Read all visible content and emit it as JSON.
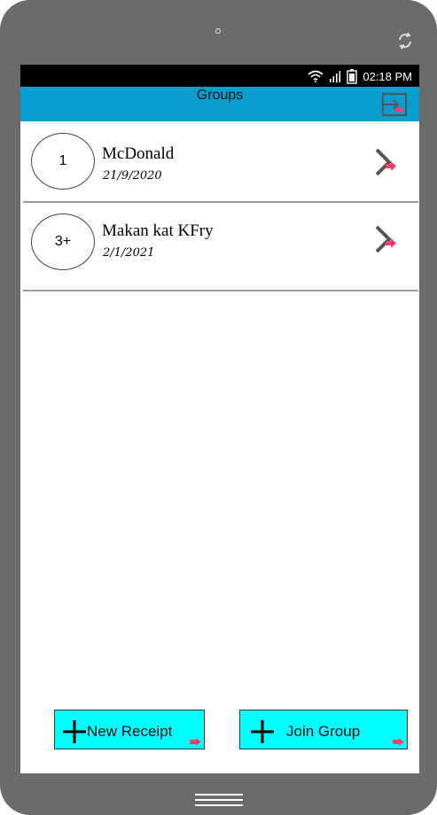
{
  "device": {
    "camera_icon": "front-camera-dot",
    "rotate_icon": "rotate-icon",
    "home_icon": "menu-lines-icon"
  },
  "status_bar": {
    "time": "02:18 PM",
    "icons": [
      "wifi-icon",
      "signal-icon",
      "battery-icon"
    ]
  },
  "app_bar": {
    "title": "Groups",
    "logout_icon": "logout-icon"
  },
  "groups": [
    {
      "badge": "1",
      "name": "McDonald",
      "date": "21/9/2020"
    },
    {
      "badge": "3+",
      "name": "Makan kat KFry",
      "date": "2/1/2021"
    }
  ],
  "buttons": {
    "new_receipt": "New Receipt",
    "join_group": "Join Group"
  },
  "colors": {
    "app_bar": "#0a9ecf",
    "button_bg": "#00ffff",
    "device_frame": "#6b6b6b",
    "status_bar": "#000000",
    "marker": "#ff3c6e"
  }
}
